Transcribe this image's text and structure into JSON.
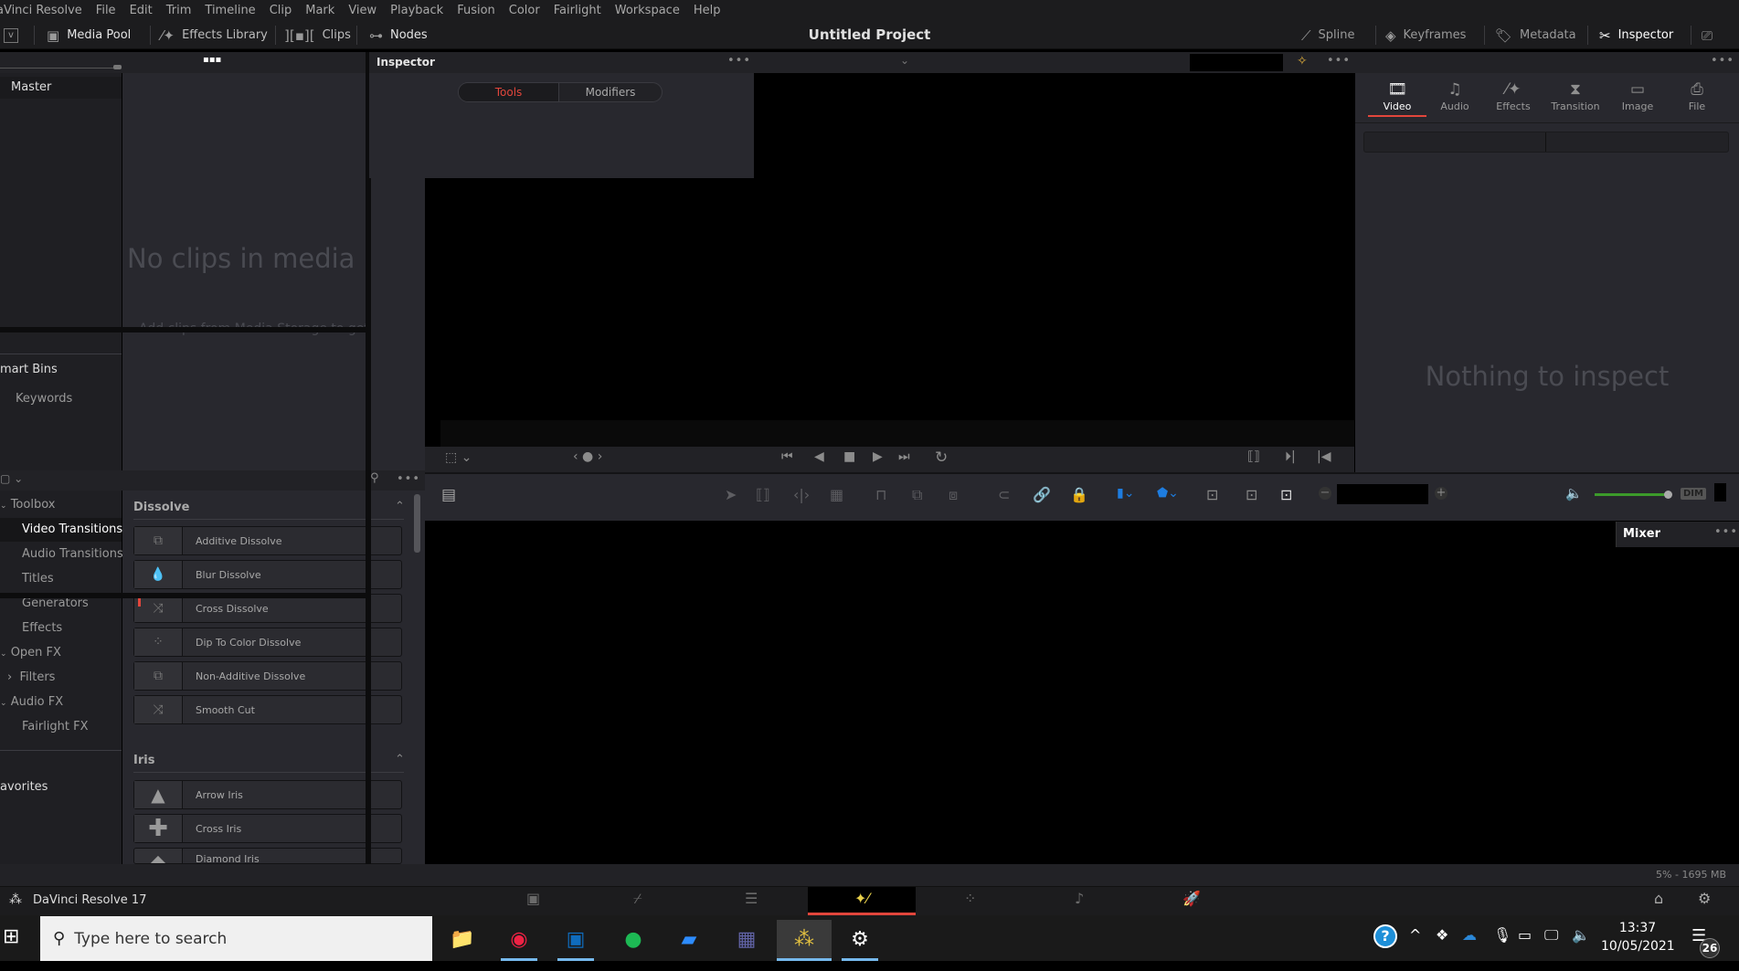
{
  "menu": [
    "aVinci Resolve",
    "File",
    "Edit",
    "Trim",
    "Timeline",
    "Clip",
    "Mark",
    "View",
    "Playback",
    "Fusion",
    "Color",
    "Fairlight",
    "Workspace",
    "Help"
  ],
  "toolbar": {
    "media_pool": "Media Pool",
    "effects_library": "Effects Library",
    "clips": "Clips",
    "nodes": "Nodes",
    "project_title": "Untitled Project",
    "spline": "Spline",
    "keyframes": "Keyframes",
    "metadata": "Metadata",
    "inspector": "Inspector"
  },
  "bins": {
    "master": "Master",
    "smart_bins": "mart Bins",
    "keywords": "Keywords"
  },
  "media_pool": {
    "empty_title": "No clips in media pool",
    "empty_hint": "Add clips from Media Storage to get started"
  },
  "fusion_inspector": {
    "title": "Inspector",
    "tabs": [
      "Tools",
      "Modifiers"
    ],
    "active_tab": "Tools"
  },
  "effects_tree": [
    {
      "label": "Toolbox",
      "level": 0
    },
    {
      "label": "Video Transitions",
      "level": 1,
      "selected": true
    },
    {
      "label": "Audio Transitions",
      "level": 1
    },
    {
      "label": "Titles",
      "level": 1
    },
    {
      "label": "Generators",
      "level": 1
    },
    {
      "label": "Effects",
      "level": 1
    },
    {
      "label": "Open FX",
      "level": 0
    },
    {
      "label": "Filters",
      "level": 1
    },
    {
      "label": "Audio FX",
      "level": 0
    },
    {
      "label": "Fairlight FX",
      "level": 1
    }
  ],
  "favorites": "avorites",
  "effects": {
    "groups": [
      {
        "name": "Dissolve",
        "items": [
          "Additive Dissolve",
          "Blur Dissolve",
          "Cross Dissolve",
          "Dip To Color Dissolve",
          "Non-Additive Dissolve",
          "Smooth Cut"
        ]
      },
      {
        "name": "Iris",
        "items": [
          "Arrow Iris",
          "Cross Iris",
          "Diamond Iris"
        ]
      }
    ]
  },
  "inspector": {
    "tabs": [
      "Video",
      "Audio",
      "Effects",
      "Transition",
      "Image",
      "File"
    ],
    "active_tab": "Video",
    "empty": "Nothing to inspect"
  },
  "mixer": {
    "title": "Mixer",
    "dim": "DIM",
    "volume": 0.95
  },
  "status": {
    "memory": "5% - 1695 MB",
    "app": "DaVinci Resolve 17"
  },
  "taskbar": {
    "search_placeholder": "Type here to search",
    "time": "13:37",
    "date": "10/05/2021",
    "notifications": "26"
  },
  "colors": {
    "accent_red": "#e2463c",
    "volume_green": "#3c9a2a",
    "marker_blue": "#1e7de0"
  }
}
